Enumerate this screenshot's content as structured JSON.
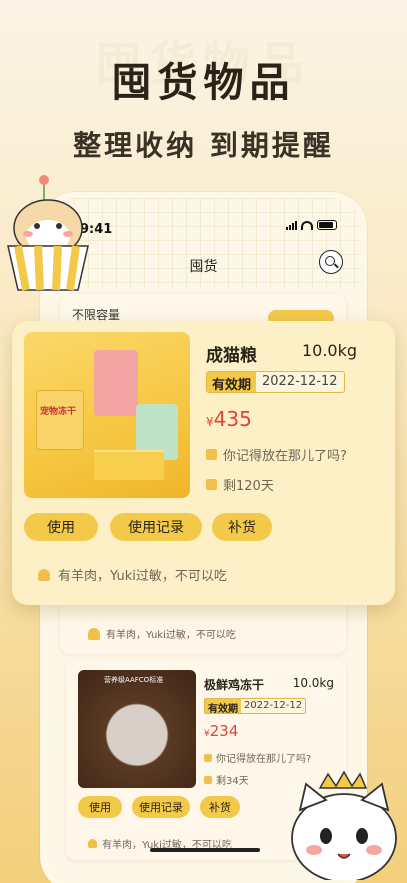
{
  "banner": {
    "watermark": "囤货物品",
    "headline": "囤货物品",
    "subheadline": "整理收纳  到期提醒"
  },
  "status_bar": {
    "time": "9:41"
  },
  "nav": {
    "title": "囤货"
  },
  "background_card": {
    "title": "不限容量",
    "memo": "有羊肉，Yuki过敏，不可以吃"
  },
  "featured_item": {
    "name": "成猫粮",
    "weight": "10.0kg",
    "expiry_label": "有效期",
    "expiry_date": "2022-12-12",
    "currency": "¥",
    "price": "435",
    "location_prompt": "你记得放在那儿了吗?",
    "remaining": "剩120天",
    "image_caption": "宠物冻干",
    "buttons": {
      "use": "使用",
      "record": "使用记录",
      "restock": "补货"
    },
    "memo": "有羊肉，Yuki过敏，不可以吃"
  },
  "second_item": {
    "name": "极鲜鸡冻干",
    "weight": "10.0kg",
    "expiry_label": "有效期",
    "expiry_date": "2022-12-12",
    "currency": "¥",
    "price": "234",
    "location_prompt": "你记得放在那儿了吗?",
    "remaining": "剩34天",
    "image_caption": "营养级AAFCO标准",
    "buttons": {
      "use": "使用",
      "record": "使用记录",
      "restock": "补货"
    },
    "memo": "有羊肉，Yuki过敏，不可以吃"
  },
  "colors": {
    "accent": "#f3c94a",
    "price": "#e04437",
    "card_bg": "#fdf0c6"
  }
}
